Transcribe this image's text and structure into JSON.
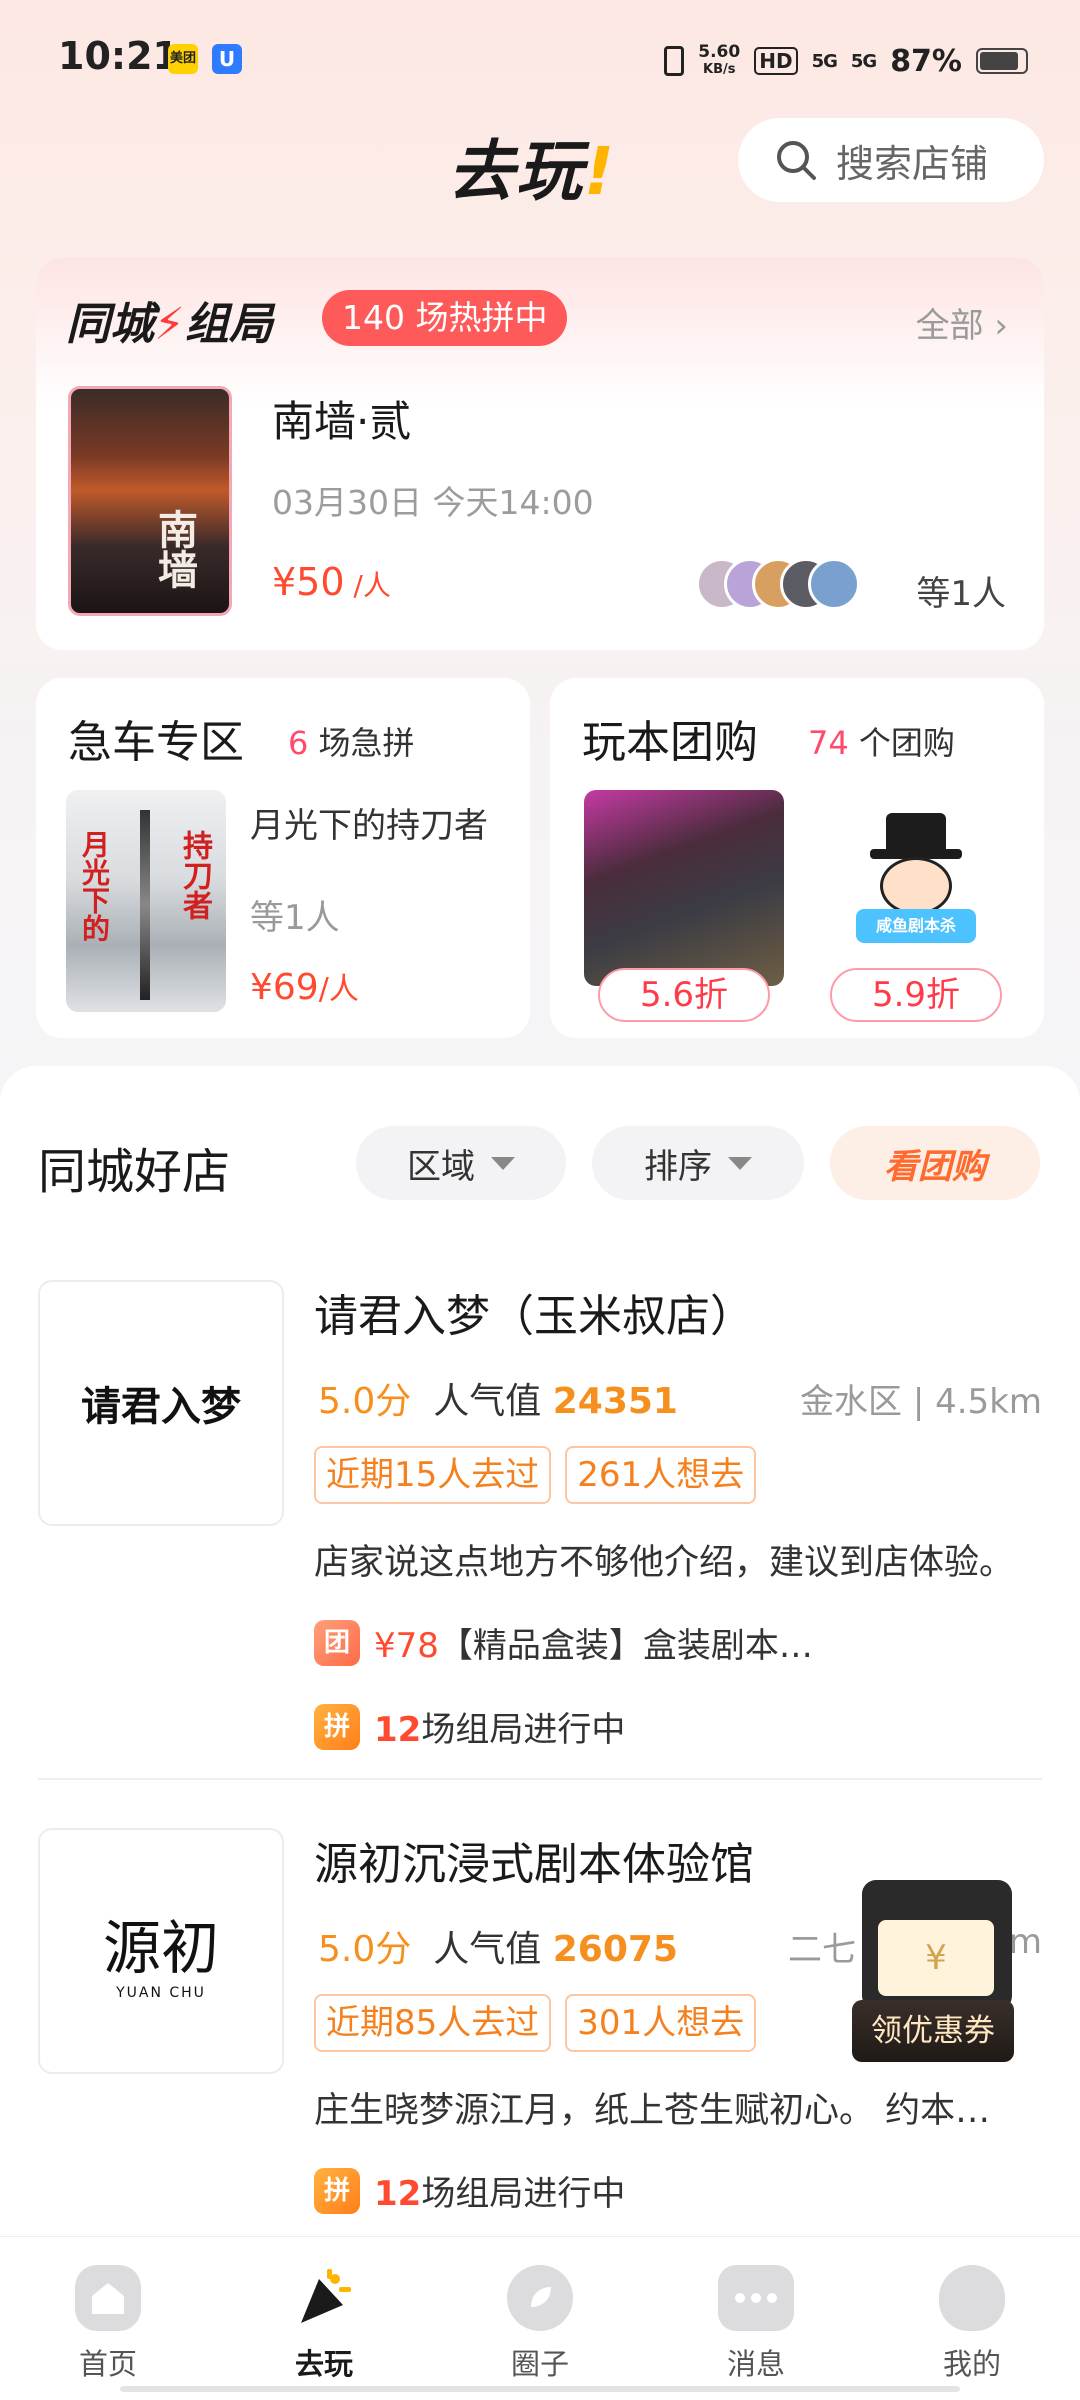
{
  "status_bar": {
    "time": "10:21",
    "app1": "美团",
    "app2": "U",
    "speed_top": "5.60",
    "speed_unit": "KB/s",
    "hd": "HD",
    "signal1": "5G",
    "signal2": "5G",
    "battery": "87%",
    "battery_level": 0.87
  },
  "header": {
    "logo": "去玩",
    "logo_bang": "!",
    "search_placeholder": "搜索店铺"
  },
  "group": {
    "title_a": "同城",
    "title_b": "组局",
    "badge": "140 场热拼中",
    "all_link": "全部 ›",
    "poster_text": "南墙",
    "name": "南墙·贰",
    "time": "03月30日 今天14:00",
    "price": "¥50",
    "price_unit": " /人",
    "participants": "等1人"
  },
  "urgent": {
    "title": "急车专区",
    "count_num": "6",
    "count_label": "场急拼",
    "poster_left": "月光下的",
    "poster_right": "持刀者",
    "name": "月光下的持刀者",
    "participants": "等1人",
    "price": "¥69",
    "price_unit": "/人"
  },
  "group_buy": {
    "title": "玩本团购",
    "count_num": "74",
    "count_label": "个团购",
    "mascot_label": "咸鱼剧本杀",
    "deals": [
      {
        "discount": "5.6折"
      },
      {
        "discount": "5.9折"
      }
    ]
  },
  "shops_section": {
    "title": "同城好店",
    "filter_area": "区域",
    "filter_sort": "排序",
    "filter_group": "看团购"
  },
  "shops": [
    {
      "logo_text": "请君入梦",
      "name": "请君入梦（玉米叔店）",
      "score": "5.0分",
      "pop_label": "人气值",
      "pop_value": "24351",
      "distance": "金水区 | 4.5km",
      "tag1": "近期15人去过",
      "tag2": "261人想去",
      "desc": "店家说这点地方不够他介绍，建议到店体验。",
      "deal_icon": "团",
      "deal_price": "¥78",
      "deal_text": "【精品盒装】盒装剧本…",
      "game_icon": "拼",
      "game_num": "12",
      "game_text": "场组局进行中"
    },
    {
      "logo_text": "源初",
      "logo_sub": "YUAN CHU",
      "name": "源初沉浸式剧本体验馆",
      "score": "5.0分",
      "pop_label": "人气值",
      "pop_value": "26075",
      "distance": "二七",
      "distance_tail": "km",
      "tag1": "近期85人去过",
      "tag2": "301人想去",
      "desc": "庄生晓梦源江月，纸上苍生赋初心。 约本…",
      "game_icon": "拼",
      "game_num": "12",
      "game_text": "场组局进行中"
    }
  ],
  "coupon": {
    "symbol": "¥",
    "label": "领优惠券"
  },
  "bottom_nav": [
    {
      "label": "首页",
      "icon": "home-icon"
    },
    {
      "label": "去玩",
      "icon": "play-icon"
    },
    {
      "label": "圈子",
      "icon": "circle-icon"
    },
    {
      "label": "消息",
      "icon": "message-icon"
    },
    {
      "label": "我的",
      "icon": "profile-icon"
    }
  ],
  "colors": {
    "accent_red": "#ff4a2f",
    "accent_orange": "#f5901e",
    "badge_red": "#ff5a5a"
  }
}
